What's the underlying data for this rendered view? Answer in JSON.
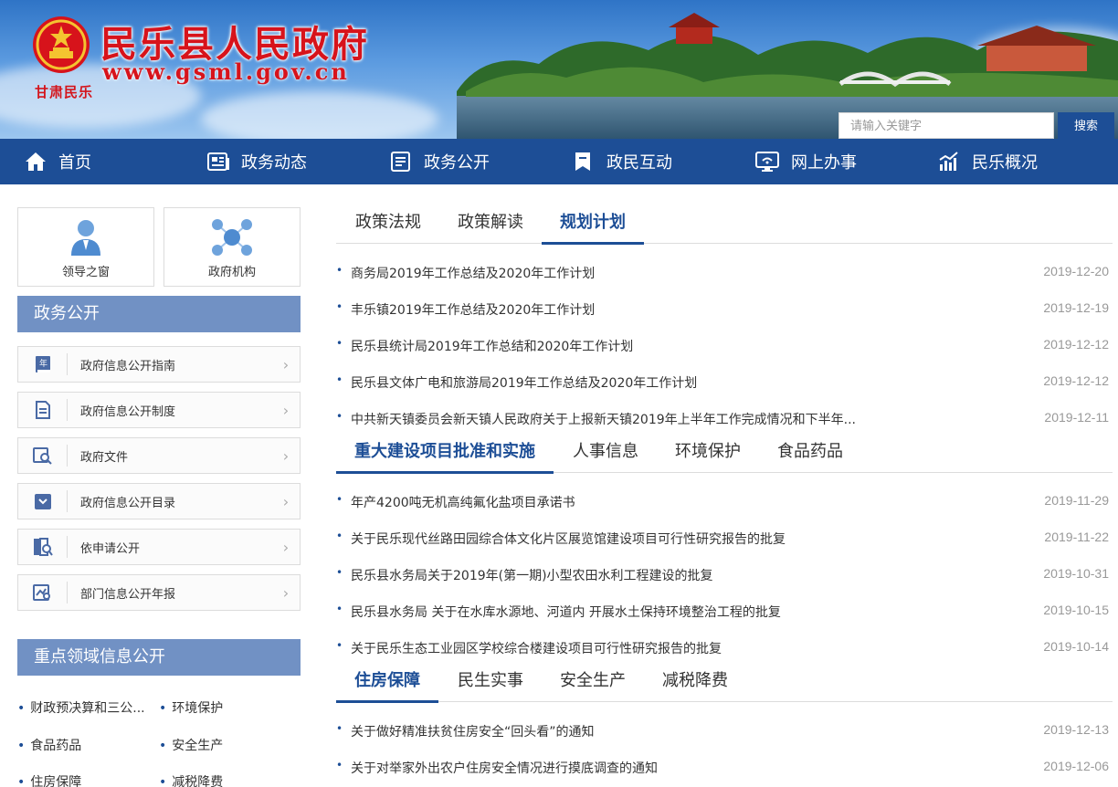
{
  "header": {
    "site_title": "民乐县人民政府",
    "site_url": "www.gsml.gov.cn",
    "place_tag": "甘肃民乐",
    "search_placeholder": "请输入关键字",
    "search_button": "搜索"
  },
  "nav": [
    {
      "label": "首页",
      "icon": "home-icon"
    },
    {
      "label": "政务动态",
      "icon": "newspaper-icon"
    },
    {
      "label": "政务公开",
      "icon": "document-list-icon"
    },
    {
      "label": "政民互动",
      "icon": "bookmark-icon"
    },
    {
      "label": "网上办事",
      "icon": "monitor-icon"
    },
    {
      "label": "民乐概况",
      "icon": "bar-chart-icon"
    }
  ],
  "quick_links": [
    {
      "label": "领导之窗",
      "icon": "person-icon"
    },
    {
      "label": "政府机构",
      "icon": "network-icon"
    }
  ],
  "sidebar": {
    "section1_title": "政务公开",
    "items": [
      {
        "label": "政府信息公开指南",
        "icon": "calendar-book-icon"
      },
      {
        "label": "政府信息公开制度",
        "icon": "document-icon"
      },
      {
        "label": "政府文件",
        "icon": "search-document-icon"
      },
      {
        "label": "政府信息公开目录",
        "icon": "folder-icon"
      },
      {
        "label": "依申请公开",
        "icon": "book-search-icon"
      },
      {
        "label": "部门信息公开年报",
        "icon": "report-icon"
      }
    ],
    "section2_title": "重点领域信息公开",
    "key_areas": [
      "财政预决算和三公...",
      "环境保护",
      "食品药品",
      "安全生产",
      "住房保障",
      "减税降费"
    ]
  },
  "panels": [
    {
      "tabs": [
        "政策法规",
        "政策解读",
        "规划计划"
      ],
      "active": 2,
      "items": [
        {
          "title": "商务局2019年工作总结及2020年工作计划",
          "date": "2019-12-20"
        },
        {
          "title": "丰乐镇2019年工作总结及2020年工作计划",
          "date": "2019-12-19"
        },
        {
          "title": "民乐县统计局2019年工作总结和2020年工作计划",
          "date": "2019-12-12"
        },
        {
          "title": "民乐县文体广电和旅游局2019年工作总结及2020年工作计划",
          "date": "2019-12-12"
        },
        {
          "title": "中共新天镇委员会新天镇人民政府关于上报新天镇2019年上半年工作完成情况和下半年...",
          "date": "2019-12-11"
        }
      ]
    },
    {
      "tabs": [
        "重大建设项目批准和实施",
        "人事信息",
        "环境保护",
        "食品药品"
      ],
      "active": 0,
      "items": [
        {
          "title": "年产4200吨无机高纯氟化盐项目承诺书",
          "date": "2019-11-29"
        },
        {
          "title": "关于民乐现代丝路田园综合体文化片区展览馆建设项目可行性研究报告的批复",
          "date": "2019-11-22"
        },
        {
          "title": "民乐县水务局关于2019年(第一期)小型农田水利工程建设的批复",
          "date": "2019-10-31"
        },
        {
          "title": "民乐县水务局 关于在水库水源地、河道内 开展水土保持环境整治工程的批复",
          "date": "2019-10-15"
        },
        {
          "title": "关于民乐生态工业园区学校综合楼建设项目可行性研究报告的批复",
          "date": "2019-10-14"
        }
      ]
    },
    {
      "tabs": [
        "住房保障",
        "民生实事",
        "安全生产",
        "减税降费"
      ],
      "active": 0,
      "items": [
        {
          "title": "关于做好精准扶贫住房安全“回头看”的通知",
          "date": "2019-12-13"
        },
        {
          "title": "关于对举家外出农户住房安全情况进行摸底调查的通知",
          "date": "2019-12-06"
        }
      ]
    }
  ],
  "colors": {
    "primary": "#1d4e96",
    "sidebar_head": "#7191c4",
    "title_red": "#d7131b"
  }
}
